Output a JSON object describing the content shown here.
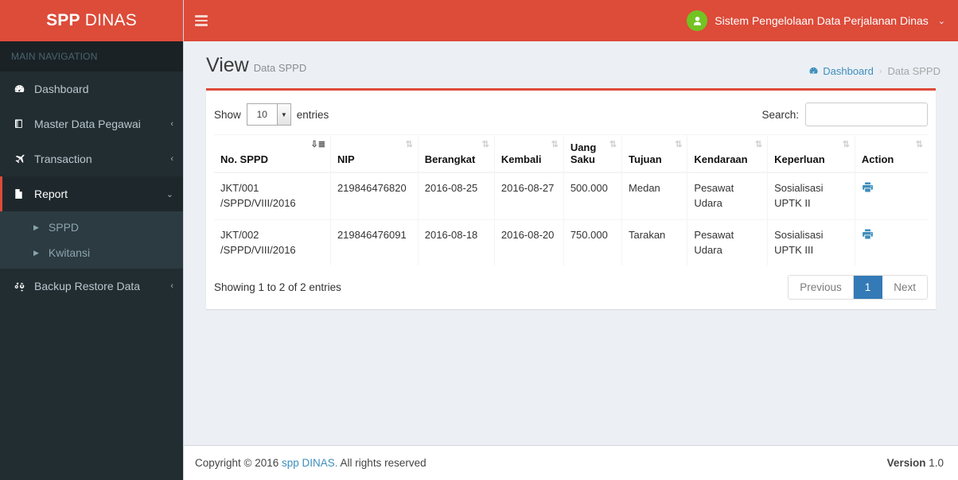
{
  "brand": {
    "bold": "SPP",
    "light": "DINAS"
  },
  "topbar": {
    "hamburger_icon": "bars-icon",
    "user_name": "Sistem Pengelolaan Data Perjalanan Dinas",
    "user_icon": "user-avatar-icon",
    "caret": "⌄"
  },
  "sidebar": {
    "header": "MAIN NAVIGATION",
    "items": [
      {
        "label": "Dashboard",
        "icon": "dashboard-icon",
        "arrow": ""
      },
      {
        "label": "Master Data Pegawai",
        "icon": "book-icon",
        "arrow": "‹"
      },
      {
        "label": "Transaction",
        "icon": "plane-icon",
        "arrow": "‹"
      },
      {
        "label": "Report",
        "icon": "file-icon",
        "arrow": "⌄"
      },
      {
        "label": "Backup Restore Data",
        "icon": "cogs-icon",
        "arrow": "‹"
      }
    ],
    "submenu": [
      {
        "label": "SPPD",
        "icon": "caret-right-icon"
      },
      {
        "label": "Kwitansi",
        "icon": "caret-right-icon"
      }
    ]
  },
  "page": {
    "title": "View",
    "subtitle": "Data SPPD",
    "breadcrumb": {
      "home_icon": "dashboard-icon",
      "home": "Dashboard",
      "separator": "›",
      "current": "Data SPPD"
    }
  },
  "datatable": {
    "show_label": "Show",
    "length_value": "10",
    "entries_label": "entries",
    "search_label": "Search:",
    "search_value": "",
    "search_placeholder": "",
    "columns": [
      {
        "label": "No. SPPD",
        "sort": "sort-amount-asc-icon",
        "active": true
      },
      {
        "label": "NIP",
        "sort": "sort-icon",
        "active": false
      },
      {
        "label": "Berangkat",
        "sort": "sort-icon",
        "active": false
      },
      {
        "label": "Kembali",
        "sort": "sort-icon",
        "active": false
      },
      {
        "label": "Uang Saku",
        "sort": "sort-icon",
        "active": false
      },
      {
        "label": "Tujuan",
        "sort": "sort-icon",
        "active": false
      },
      {
        "label": "Kendaraan",
        "sort": "sort-icon",
        "active": false
      },
      {
        "label": "Keperluan",
        "sort": "sort-icon",
        "active": false
      },
      {
        "label": "Action",
        "sort": "sort-icon",
        "active": false
      }
    ],
    "rows": [
      {
        "no_sppd": "JKT/001 /SPPD/VIII/2016",
        "nip": "219846476820",
        "berangkat": "2016-08-25",
        "kembali": "2016-08-27",
        "uang_saku": "500.000",
        "tujuan": "Medan",
        "kendaraan": "Pesawat Udara",
        "keperluan": "Sosialisasi UPTK II",
        "action_icon": "print-icon"
      },
      {
        "no_sppd": "JKT/002 /SPPD/VIII/2016",
        "nip": "219846476091",
        "berangkat": "2016-08-18",
        "kembali": "2016-08-20",
        "uang_saku": "750.000",
        "tujuan": "Tarakan",
        "kendaraan": "Pesawat Udara",
        "keperluan": "Sosialisasi UPTK III",
        "action_icon": "print-icon"
      }
    ],
    "info": "Showing 1 to 2 of 2 entries",
    "pagination": {
      "previous": "Previous",
      "pages": [
        "1"
      ],
      "next": "Next",
      "active_page": "1"
    }
  },
  "footer": {
    "copyright_pre": "Copyright © 2016 ",
    "link": "spp DINAS.",
    "copyright_post": " All rights reserved",
    "version_label": "Version",
    "version_value": "1.0"
  },
  "colors": {
    "brand_red": "#dd4b39",
    "sidebar_dark": "#222d32",
    "sidebar_submenu": "#2c3b41",
    "accent_blue": "#3c8dbc",
    "pager_active": "#337ab7",
    "avatar_green": "#73c322",
    "body_bg": "#ecf0f5"
  }
}
